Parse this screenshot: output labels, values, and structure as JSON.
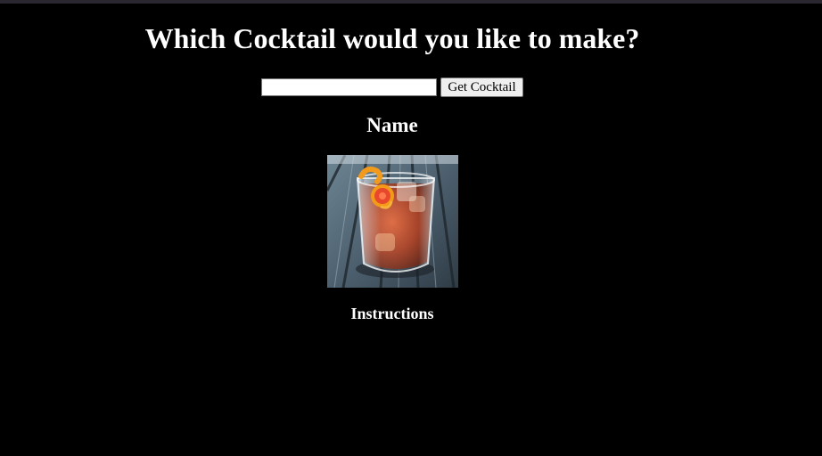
{
  "page": {
    "title": "Which Cocktail would you like to make?",
    "search": {
      "value": "",
      "placeholder": ""
    },
    "button_label": "Get Cocktail",
    "name_heading": "Name",
    "instructions_heading": "Instructions",
    "image_icon": "cocktail-photo"
  },
  "colors": {
    "background": "#000000",
    "text": "#ffffff",
    "top_bar": "#2b2730"
  }
}
